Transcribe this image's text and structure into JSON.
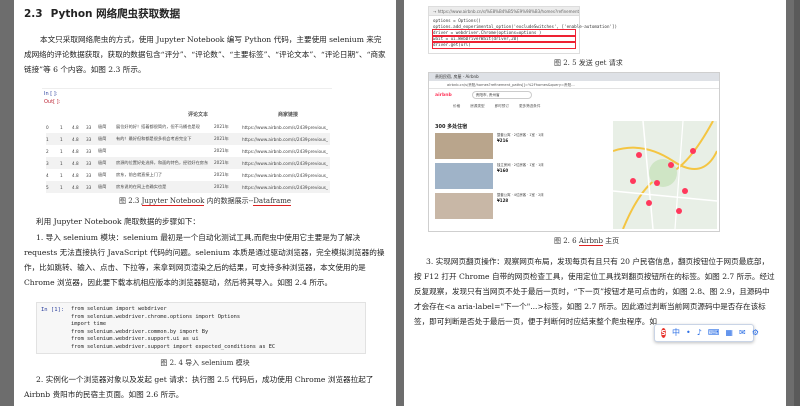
{
  "left_page": {
    "section_number": "2.3",
    "section_title": "Python 网络爬虫获取数据",
    "intro_para": "本文只采取网络爬虫的方式，使用 Jupyter Notebook 编写 Python 代码，主要使用 selenium 来完成网络的评论数据获取，获取的数据包含“评分”、“评论数”、“主要标签”、“评论文本”、“评论日期”、“商家链接”等 6 个内容。如图 2.3 所示。",
    "table_image": {
      "prompt_in": "In [ ]:",
      "prompt_out": "Out[ ]:",
      "header_text": "评论文本",
      "header_link": "商家链接",
      "rows": [
        [
          "0",
          "1",
          "4.8",
          "33",
          "极简",
          "展位好的好！搭着都很简约，但不马桶也是现",
          "2021年",
          "https://www.airbnb.com/s/24396317",
          "previous_"
        ],
        [
          "1",
          "1",
          "4.8",
          "33",
          "极简",
          "有的！最好但和都是很多机会考虑完全下",
          "2021年",
          "https://www.airbnb.com/s/24396317",
          "previous_"
        ],
        [
          "2",
          "1",
          "4.8",
          "33",
          "极简",
          "",
          "2021年",
          "https://www.airbnb.com/s/24396317",
          "previous_"
        ],
        [
          "3",
          "1",
          "4.8",
          "33",
          "极简",
          "房源的位置好处选择，和面的特色，经验好在房东",
          "2021年",
          "https://www.airbnb.com/s/24396317",
          "previous_"
        ],
        [
          "4",
          "1",
          "4.8",
          "33",
          "极简",
          "房东，前台就直接上门了",
          "2021年",
          "https://www.airbnb.com/s/24396317",
          "previous_"
        ],
        [
          "5",
          "1",
          "4.8",
          "33",
          "极简",
          "房东说的在网上也确实也是",
          "2021年",
          "https://www.airbnb.com/s/24396317",
          "previous_"
        ]
      ]
    },
    "caption_2_3_pre": "图 2.3 ",
    "caption_2_3_link": "Jupyter Notebook",
    "caption_2_3_post": " 内的数据展示--",
    "caption_2_3_tail": "Dataframe",
    "steps_intro": "利用 Jupyter Notebook 爬取数据的步骤如下：",
    "step1_para": "1. 导入 selenium 模块：selenium 最初是一个自动化测试工具,而爬虫中使用它主要是为了解决 requests 无法直接执行 JavaScript 代码的问题。selenium 本质是通过驱动浏览器，完全模拟浏览器的操作，比如跳转、输入、点击、下拉等，来拿到网页渲染之后的结果，可支持多种浏览器，本文使用的是 Chrome 浏览器，因此要下载本机相应版本的浏览器驱动，然后将其导入。如图 2.4 所示。",
    "code_image": {
      "prompt": "In [1]:",
      "lines": [
        "from selenium import webdriver",
        "from selenium.webdriver.chrome.options import Options",
        "import time",
        "from selenium.webdriver.common.by import By",
        "from selenium.webdriver.support.ui as ui",
        "from selenium.webdriver.support import expected_conditions as EC"
      ]
    },
    "caption_2_4": "图 2. 4 导入 selenium 模块",
    "step2_para": "2. 实例化一个浏览器对象以及发起 get 请求：执行图 2.5 代码后，成功使用 Chrome 浏览器拉起了 Airbnb 贵阳市的民宿主页面。如图 2.6 所示。"
  },
  "right_page": {
    "code_image": {
      "url_bar": "→ https://www.airbnb.cn/s/%E8%B4%B5%E9%98%B3/homes?refinement_paths%5B%5D=%2Fhomes&query=",
      "lines": [
        "options = Options()",
        "options.add_experimental_option('excludeSwitches', ['enable-automation'])",
        "driver = webdriver.Chrome(options=options )",
        "wait = ui.WebDriverWait(driver,20)",
        "driver.get(url)"
      ]
    },
    "caption_2_5": "图 2. 5 发送 get 请求",
    "browser": {
      "tab_label": "贵阳民宿, 房屋 - Airbnb",
      "address": "airbnb.cn/s/贵阳/homes?refinement_paths[]=%2Fhomes&query=贵阳...",
      "brand": "airbnb",
      "search_text": "贵阳市, 贵州省",
      "categories": [
        "价格",
        "房源类型",
        "即时预订",
        "更多筛选条件"
      ],
      "list_title": "300 多处住宿",
      "listings": [
        {
          "info": "整套公寓 · 2位房客 · 1室 · 1床",
          "price": "¥216"
        },
        {
          "info": "独立房间 · 2位房客 · 1室 · 1床",
          "price": "¥160"
        },
        {
          "info": "整套公寓 · 4位房客 · 2室 · 2床",
          "price": "¥128"
        }
      ]
    },
    "caption_2_6_pre": "图 2. 6 ",
    "caption_2_6_link": "Airbnb",
    "caption_2_6_post": " 主页",
    "step3_para": "3. 实现网页翻页操作：观察网页布局，发现每页有且只有 20 户民宿信息，翻页按钮位于网页最底部，按 F12 打开 Chrome 自带的网页检查工具，使用定位工具找到翻页按钮所在的标签。如图 2.7 所示。经过反复观察，发现只有当网页不处于最后一页时，“下一页”按钮才是可点击的，如图 2.8、图 2.9，且源码中才会存在<a aria-label=\"下一个\"...>标签，如图 2.7 所示。因此通过判断当前网页源码中是否存在该标签，即可判断是否处于最后一页，便于判断何时应结束整个爬虫程序。如"
  },
  "ime_toolbar": {
    "logo": "S",
    "items": [
      "中",
      "•",
      "♪",
      "⌨",
      "▦",
      "✉",
      "⚙"
    ]
  },
  "colors": {
    "page": "#ffffff",
    "desk": "#6d6d6d",
    "link_blue": "#1a56c4",
    "error_red": "#dd2222",
    "airbnb": "#ff385c"
  }
}
